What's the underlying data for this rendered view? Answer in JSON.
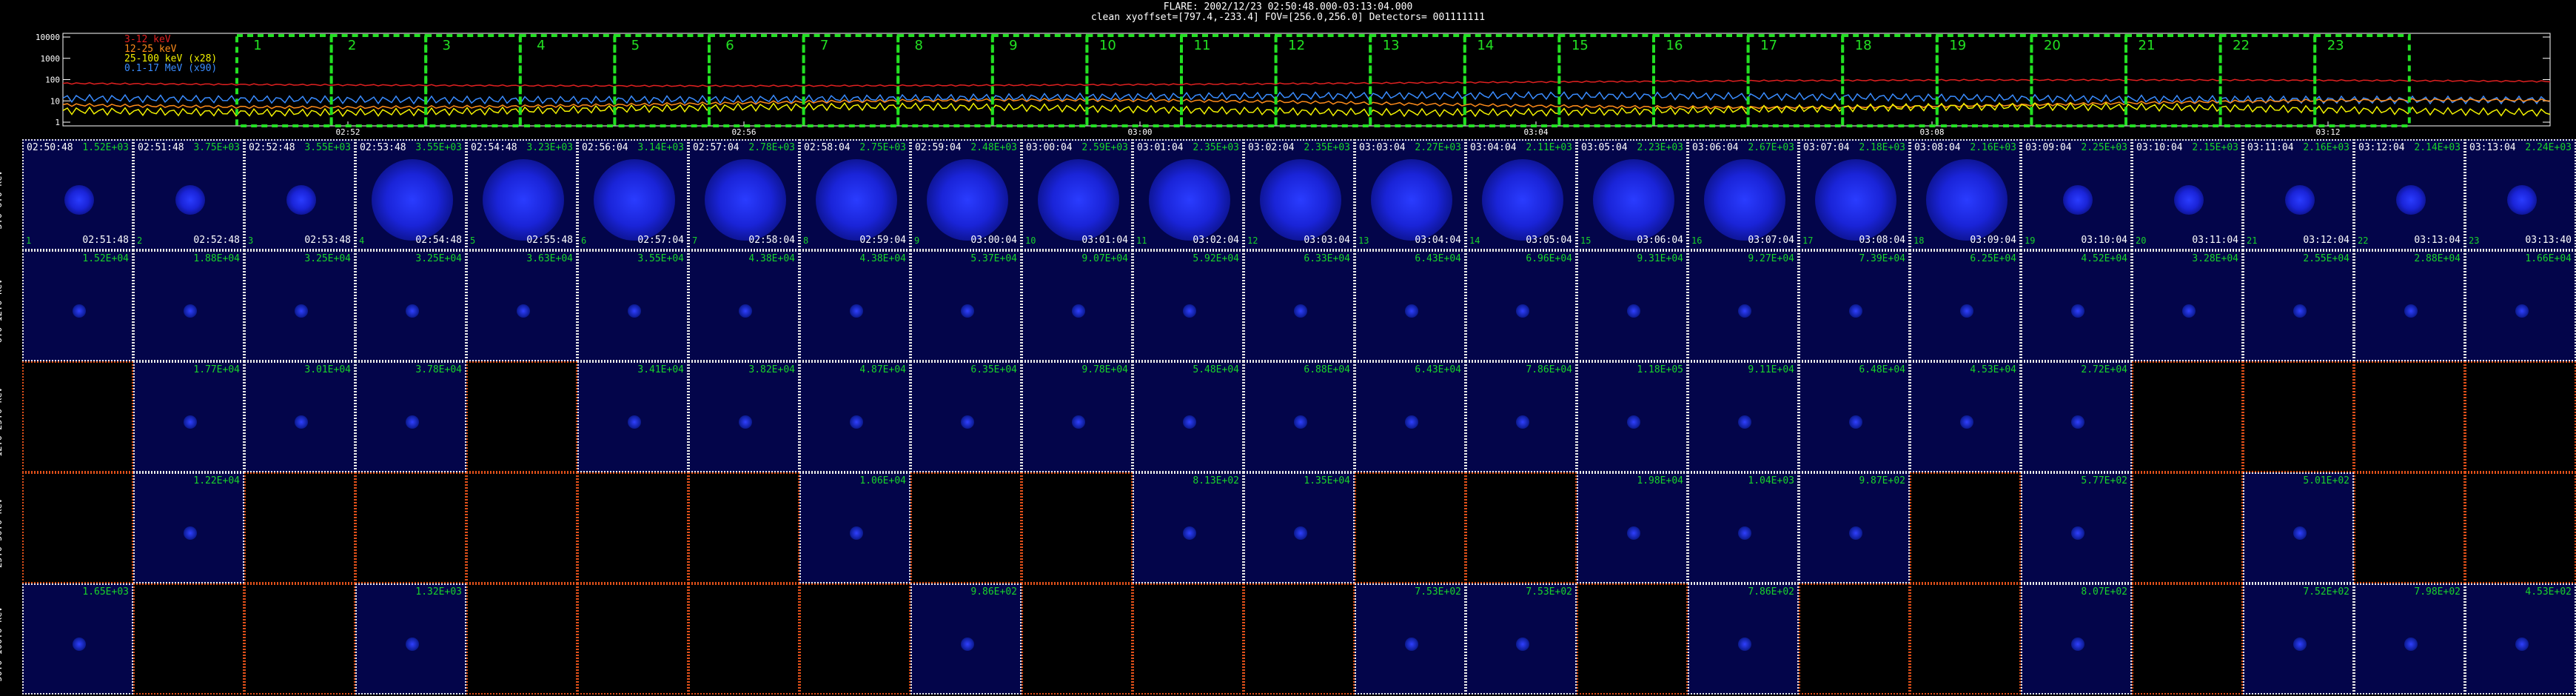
{
  "header": {
    "title": "FLARE: 2002/12/23 02:50:48.000-03:13:04.000",
    "params": "clean    xyoffset=[797.4,-233.4]    FOV=[256.0,256.0]    Detectors= 001111111"
  },
  "lightcurve": {
    "legend": [
      {
        "label": "3-12 keV",
        "color": "#e02020"
      },
      {
        "label": "12-25 keV",
        "color": "#ff8c1a"
      },
      {
        "label": "25-100 keV (x28)",
        "color": "#f2f200"
      },
      {
        "label": "0.1-17 MeV (x90)",
        "color": "#3a8cff"
      }
    ],
    "yticks": [
      "10000",
      "1000",
      "100",
      "10",
      "1"
    ],
    "xticks": [
      "02:52",
      "02:56",
      "03:00",
      "03:04",
      "03:08",
      "03:12"
    ],
    "intervals": [
      "1",
      "2",
      "3",
      "4",
      "5",
      "6",
      "7",
      "8",
      "9",
      "10",
      "11",
      "12",
      "13",
      "14",
      "15",
      "16",
      "17",
      "18",
      "19",
      "20",
      "21",
      "22",
      "23"
    ]
  },
  "energy_bands": [
    "3.0-6.0 keV",
    "6.0-12.0 keV",
    "12.0-25.0 keV",
    "25.0-50.0 keV",
    "50.0-100.0 keV"
  ],
  "start_times": [
    "02:50:48",
    "02:51:48",
    "02:52:48",
    "02:53:48",
    "02:54:48",
    "02:56:04",
    "02:57:04",
    "02:58:04",
    "02:59:04",
    "03:00:04",
    "03:01:04",
    "03:02:04",
    "03:03:04",
    "03:04:04",
    "03:05:04",
    "03:06:04",
    "03:07:04",
    "03:08:04",
    "03:09:04",
    "03:10:04",
    "03:11:04",
    "03:12:04",
    "03:13:04"
  ],
  "end_times": [
    "02:51:48",
    "02:52:48",
    "02:53:48",
    "02:54:48",
    "02:55:48",
    "02:57:04",
    "02:58:04",
    "02:59:04",
    "03:00:04",
    "03:01:04",
    "03:02:04",
    "03:03:04",
    "03:04:04",
    "03:05:04",
    "03:06:04",
    "03:07:04",
    "03:08:04",
    "03:09:04",
    "03:10:04",
    "03:11:04",
    "03:12:04",
    "03:13:04",
    "03:13:40"
  ],
  "rows": [
    {
      "maxes": [
        "1.52E+03",
        "3.75E+03",
        "3.55E+03",
        "3.55E+03",
        "3.23E+03",
        "3.14E+03",
        "2.78E+03",
        "2.75E+03",
        "2.48E+03",
        "2.59E+03",
        "2.35E+03",
        "2.35E+03",
        "2.27E+03",
        "2.11E+03",
        "2.23E+03",
        "2.67E+03",
        "2.18E+03",
        "2.16E+03",
        "2.25E+03",
        "2.15E+03",
        "2.16E+03",
        "2.14E+03",
        "2.24E+03"
      ]
    },
    {
      "maxes": [
        "1.52E+04",
        "1.88E+04",
        "3.25E+04",
        "3.25E+04",
        "3.63E+04",
        "3.55E+04",
        "4.38E+04",
        "4.38E+04",
        "5.37E+04",
        "9.07E+04",
        "5.92E+04",
        "6.33E+04",
        "6.43E+04",
        "6.96E+04",
        "9.31E+04",
        "9.27E+04",
        "7.39E+04",
        "6.25E+04",
        "4.52E+04",
        "3.28E+04",
        "2.55E+04",
        "2.88E+04",
        "1.66E+04"
      ]
    },
    {
      "maxes": [
        "",
        "1.77E+04",
        "3.01E+04",
        "3.78E+04",
        "",
        "3.41E+04",
        "3.82E+04",
        "4.87E+04",
        "6.35E+04",
        "9.78E+04",
        "5.48E+04",
        "6.88E+04",
        "6.43E+04",
        "7.86E+04",
        "1.18E+05",
        "9.11E+04",
        "6.48E+04",
        "4.53E+04",
        "2.72E+04",
        "",
        "",
        "",
        ""
      ]
    },
    {
      "maxes": [
        "",
        "1.22E+04",
        "",
        "",
        "",
        "",
        "",
        "1.06E+04",
        "",
        "",
        "8.13E+02",
        "1.35E+04",
        "",
        "",
        "1.98E+04",
        "1.04E+03",
        "9.87E+02",
        "",
        "5.77E+02",
        "",
        "5.01E+02",
        "",
        ""
      ]
    },
    {
      "maxes": [
        "1.65E+03",
        "",
        "",
        "1.32E+03",
        "",
        "",
        "",
        "",
        "9.86E+02",
        "",
        "",
        "",
        "7.53E+02",
        "7.53E+02",
        "",
        "7.86E+02",
        "",
        "",
        "8.07E+02",
        "",
        "7.52E+02",
        "7.98E+02",
        "4.53E+02"
      ]
    }
  ]
}
